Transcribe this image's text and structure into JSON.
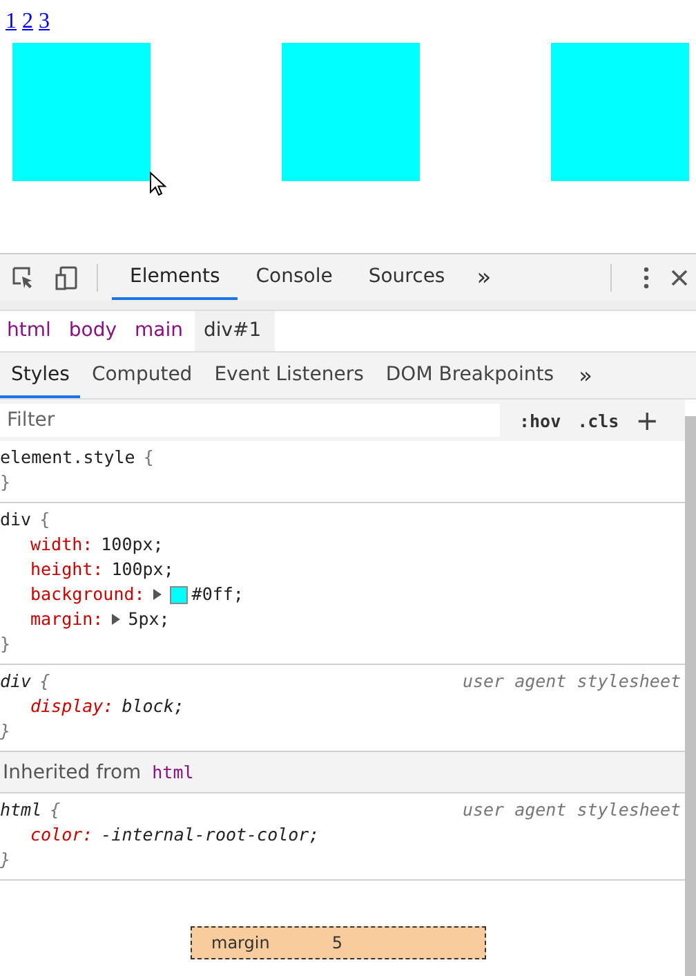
{
  "page": {
    "links": [
      "1",
      "2",
      "3"
    ],
    "boxes": [
      {
        "kind": "square"
      },
      {
        "kind": "square"
      },
      {
        "kind": "square"
      }
    ]
  },
  "devtools": {
    "tabs": [
      {
        "label": "Elements",
        "selected": true
      },
      {
        "label": "Console",
        "selected": false
      },
      {
        "label": "Sources",
        "selected": false
      }
    ],
    "more": "»",
    "breadcrumbs": [
      {
        "label": "html",
        "selected": false
      },
      {
        "label": "body",
        "selected": false
      },
      {
        "label": "main",
        "selected": false
      },
      {
        "label": "div#1",
        "selected": true
      }
    ],
    "subtabs": [
      {
        "label": "Styles",
        "selected": true
      },
      {
        "label": "Computed",
        "selected": false
      },
      {
        "label": "Event Listeners",
        "selected": false
      },
      {
        "label": "DOM Breakpoints",
        "selected": false
      }
    ],
    "subtabs_more": "»",
    "filter": {
      "placeholder": "Filter"
    },
    "hov": ":hov",
    "cls": ".cls",
    "add": "+",
    "sections": [
      {
        "kind": "rule",
        "selector": "element.style",
        "open": "{",
        "close": "}",
        "user_agent": false
      },
      {
        "kind": "rule",
        "selector": "div",
        "open": "{",
        "close": "}",
        "user_agent": false,
        "declarations": [
          {
            "property": "width:",
            "value": "100px;",
            "expandable": false
          },
          {
            "property": "height:",
            "value": "100px;",
            "expandable": false
          },
          {
            "property": "background:",
            "value": "#0ff;",
            "expandable": true,
            "color": "#00ffff"
          },
          {
            "property": "margin:",
            "value": "5px;",
            "expandable": true
          }
        ]
      },
      {
        "kind": "rule",
        "selector": "div",
        "open": "{",
        "close": "}",
        "user_agent": true,
        "source": "user agent stylesheet",
        "declarations": [
          {
            "property": "display:",
            "value": "block;",
            "expandable": false
          }
        ]
      },
      {
        "kind": "inherited",
        "label": "Inherited from",
        "element": "html"
      },
      {
        "kind": "rule",
        "selector": "html",
        "open": "{",
        "close": "}",
        "user_agent": true,
        "source": "user agent stylesheet",
        "declarations": [
          {
            "property": "color:",
            "value": "-internal-root-color;",
            "expandable": false
          }
        ]
      }
    ],
    "box_model": {
      "label": "margin",
      "value": "5"
    }
  }
}
